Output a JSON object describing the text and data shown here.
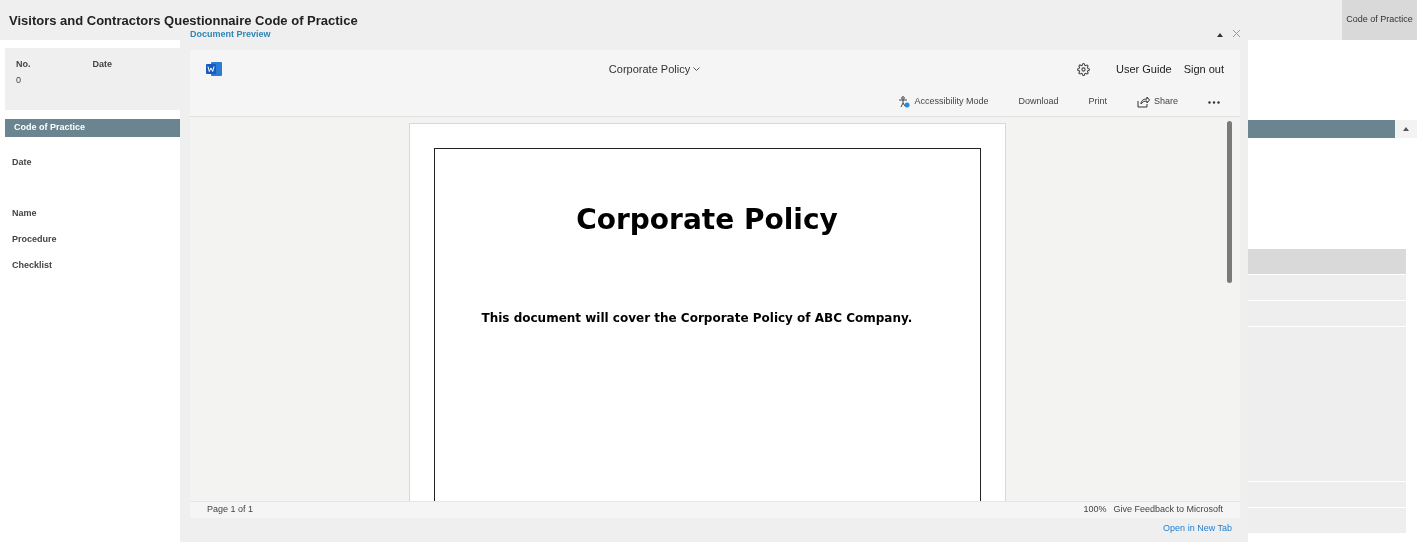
{
  "page": {
    "title": "Visitors and Contractors Questionnaire Code of Practice",
    "side_tab": "Code of Practice"
  },
  "info": [
    {
      "label": "No.",
      "value": "0"
    },
    {
      "label": "Date"
    }
  ],
  "section": {
    "title": "Code of Practice",
    "fields": [
      {
        "label": "Date",
        "kind": "date"
      },
      {
        "label": "Name",
        "kind": "text"
      },
      {
        "label": "Procedure",
        "kind": "text"
      },
      {
        "label": "Checklist",
        "kind": "text"
      }
    ]
  },
  "dialog": {
    "title": "Document Preview",
    "viewer": {
      "document_name": "Corporate Policy",
      "header_links": [
        "User Guide",
        "Sign out"
      ],
      "toolbar": [
        {
          "label": "Accessibility Mode",
          "kind": "accessibility"
        },
        {
          "label": "Download",
          "kind": "plain"
        },
        {
          "label": "Print",
          "kind": "plain"
        },
        {
          "label": "Share",
          "kind": "share"
        }
      ],
      "document": {
        "heading": "Corporate Policy",
        "body": "This document will cover the Corporate Policy of ABC Company."
      },
      "status": {
        "page": "Page 1 of 1",
        "zoom": "100%",
        "feedback": "Give Feedback to Microsoft"
      }
    },
    "link": "Open in New Tab"
  }
}
